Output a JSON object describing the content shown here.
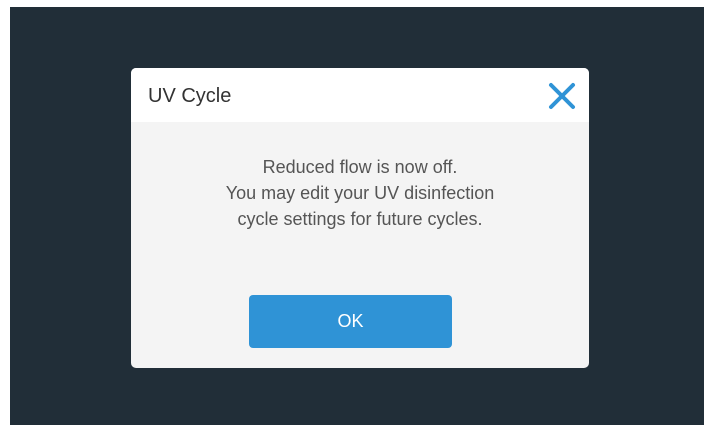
{
  "dialog": {
    "title": "UV Cycle",
    "close_icon": "close-icon",
    "message_lines": [
      "Reduced flow is now off.",
      "You may edit your UV disinfection",
      "cycle settings for future cycles."
    ],
    "ok_label": "OK"
  },
  "colors": {
    "background": "#212e38",
    "dialog_body": "#f4f4f4",
    "dialog_header": "#ffffff",
    "accent": "#2f93d6"
  }
}
